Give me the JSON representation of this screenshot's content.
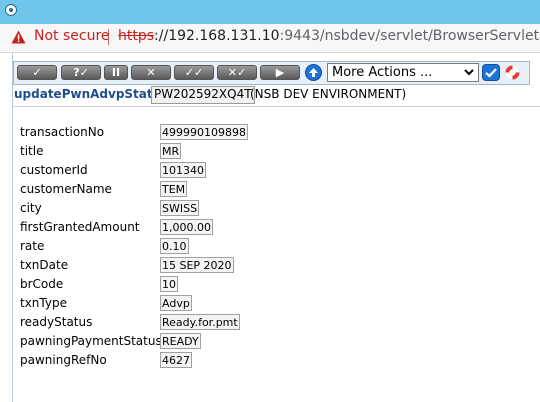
{
  "browser": {
    "security_label": "Not secure",
    "url_scheme": "https",
    "url_host": "://192.168.131.10",
    "url_rest": ":9443/nsbdev/servlet/BrowserServlet"
  },
  "toolbar": {
    "buttons": [
      {
        "icon": "check-icon",
        "glyph": "✓"
      },
      {
        "icon": "validate-icon",
        "glyph": "?✓"
      },
      {
        "icon": "hold-icon",
        "glyph": "II"
      },
      {
        "icon": "delete-icon",
        "glyph": "✕"
      },
      {
        "icon": "authorise-icon",
        "glyph": "✓✓"
      },
      {
        "icon": "reverse-icon",
        "glyph": "✕✓"
      },
      {
        "icon": "next-icon",
        "glyph": "▶"
      }
    ],
    "actions_selected": "More Actions ..."
  },
  "form": {
    "name": "updatePwnAdvpStatus",
    "record_id": "PW202592XQ4T",
    "environment": "(NSB DEV ENVIRONMENT)"
  },
  "fields": [
    {
      "label": "transactionNo",
      "value": "499990109898"
    },
    {
      "label": "title",
      "value": "MR"
    },
    {
      "label": "customerId",
      "value": "101340"
    },
    {
      "label": "customerName",
      "value": "TEM"
    },
    {
      "label": "city",
      "value": "SWISS"
    },
    {
      "label": "firstGrantedAmount",
      "value": "1,000.00"
    },
    {
      "label": "rate",
      "value": "0.10"
    },
    {
      "label": "txnDate",
      "value": "15 SEP 2020"
    },
    {
      "label": "brCode",
      "value": "10"
    },
    {
      "label": "txnType",
      "value": "Advp"
    },
    {
      "label": "readyStatus",
      "value": "Ready.for.pmt"
    },
    {
      "label": "pawningPaymentStatus",
      "value": "READY"
    },
    {
      "label": "pawningRefNo",
      "value": "4627"
    }
  ]
}
